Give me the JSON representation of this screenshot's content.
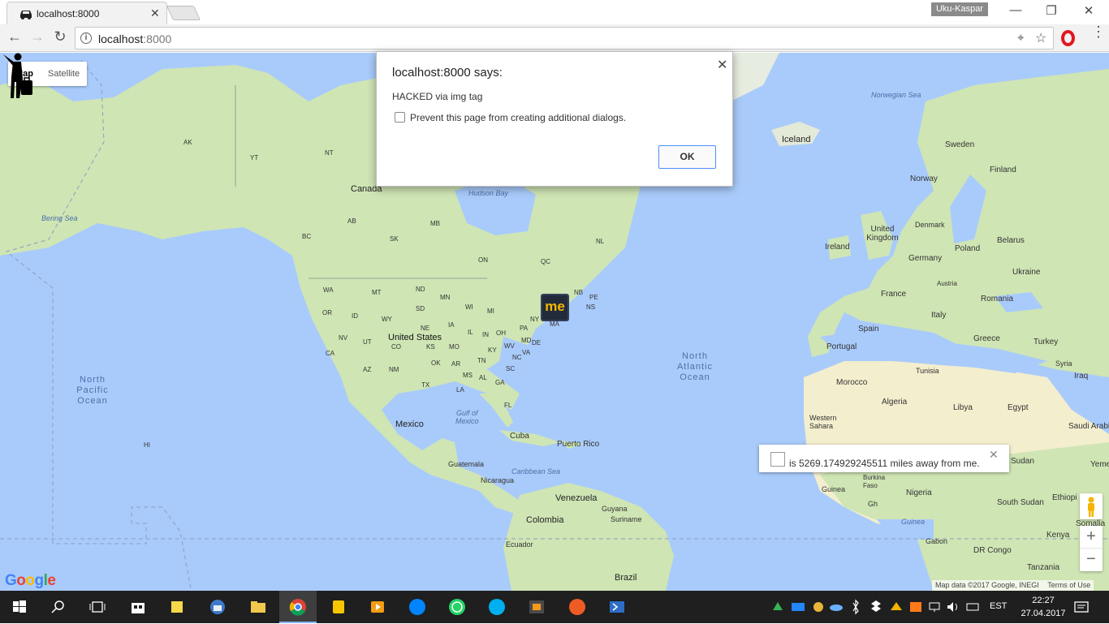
{
  "browser": {
    "tab_title": "localhost:8000",
    "close_glyph": "✕",
    "user_name": "Uku-Kaspar",
    "window_controls": [
      "—",
      "❐",
      "✕"
    ],
    "url_host": "localhost",
    "url_port": ":8000",
    "back": "←",
    "forward": "→",
    "reload": "↻",
    "location_icon": "⌖",
    "star": "☆",
    "menu": "⋮"
  },
  "map": {
    "type_buttons": [
      "Map",
      "Satellite"
    ],
    "active_type": "Map",
    "labels": {
      "canada": "Canada",
      "united_states": "United States",
      "mexico": "Mexico",
      "cuba": "Cuba",
      "puerto_rico": "Puerto Rico",
      "guatemala": "Guatemala",
      "nicaragua": "Nicaragua",
      "venezuela": "Venezuela",
      "guyana": "Guyana",
      "suriname": "Suriname",
      "colombia": "Colombia",
      "ecuador": "Ecuador",
      "brazil": "Brazil",
      "iceland": "Iceland",
      "sweden": "Sweden",
      "finland": "Finland",
      "norway": "Norway",
      "denmark": "Denmark",
      "united_kingdom": "United Kingdom",
      "ireland": "Ireland",
      "germany": "Germany",
      "poland": "Poland",
      "belarus": "Belarus",
      "ukraine": "Ukraine",
      "austria": "Austria",
      "france": "France",
      "romania": "Romania",
      "italy": "Italy",
      "spain": "Spain",
      "portugal": "Portugal",
      "greece": "Greece",
      "turkey": "Turkey",
      "tunisia": "Tunisia",
      "syria": "Syria",
      "iraq": "Iraq",
      "morocco": "Morocco",
      "algeria": "Algeria",
      "libya": "Libya",
      "egypt": "Egypt",
      "saudi_arabia": "Saudi Arabia",
      "western_sahara": "Western Sahara",
      "sudan": "Sudan",
      "burkina_faso": "Burkina Faso",
      "guinea": "Guinea",
      "nigeria": "Nigeria",
      "ghana": "Gh",
      "ethiopia": "Ethiopi",
      "south_sudan": "South Sudan",
      "somalia": "Somalia",
      "yemen": "Yeme",
      "gabon": "Gabon",
      "kenya": "Kenya",
      "dr_congo": "DR Congo",
      "tanzania": "Tanzania",
      "gulf_guinea": "Guinea",
      "ak": "AK",
      "yt": "YT",
      "nt": "NT",
      "bc": "BC",
      "ab": "AB",
      "sk": "SK",
      "mb": "MB",
      "on": "ON",
      "qc": "QC",
      "nl": "NL",
      "nb": "NB",
      "pe": "PE",
      "ns": "NS",
      "wa": "WA",
      "mt": "MT",
      "nd": "ND",
      "mn": "MN",
      "or": "OR",
      "id": "ID",
      "sd": "SD",
      "wi": "WI",
      "mi": "MI",
      "wy": "WY",
      "ia": "IA",
      "ne": "NE",
      "nv": "NV",
      "ut": "UT",
      "co": "CO",
      "ks": "KS",
      "mo": "MO",
      "il": "IL",
      "in": "IN",
      "oh": "OH",
      "pa": "PA",
      "ny": "NY",
      "ma": "MA",
      "wv": "WV",
      "va": "VA",
      "de": "DE",
      "md": "MD",
      "ky": "KY",
      "ca": "CA",
      "az": "AZ",
      "nm": "NM",
      "ok": "OK",
      "ar": "AR",
      "tn": "TN",
      "nc": "NC",
      "sc": "SC",
      "ms": "MS",
      "al": "AL",
      "ga": "GA",
      "tx": "TX",
      "la": "LA",
      "fl": "FL",
      "hi": "HI",
      "bering_sea": "Bering Sea",
      "hudson_bay": "Hudson Bay",
      "norwegian_sea": "Norwegian Sea",
      "gulf_mexico_1": "Gulf of",
      "gulf_mexico_2": "Mexico",
      "caribbean_sea": "Caribbean Sea",
      "north_pacific": "North Pacific Ocean",
      "north_atlantic": "North Atlantic Ocean"
    },
    "marker_me": "me",
    "info_window_text": "is 5269.174929245511 miles away from me.",
    "info_close": "✕",
    "zoom_in": "+",
    "zoom_out": "−",
    "google_logo": [
      "G",
      "o",
      "o",
      "g",
      "l",
      "e"
    ],
    "attribution": "Map data ©2017 Google, INEGI",
    "terms": "Terms of Use"
  },
  "dialog": {
    "title": "localhost:8000 says:",
    "message": "HACKED via img tag",
    "checkbox_label": "Prevent this page from creating additional dialogs.",
    "ok_label": "OK",
    "close_glyph": "✕"
  },
  "taskbar": {
    "language": "EST",
    "time": "22:27",
    "date": "27.04.2017"
  },
  "colors": {
    "water": "#a9cbfb",
    "land": "#cfe5b4",
    "desert": "#f3eecd",
    "accent_blue": "#4d90fe"
  }
}
